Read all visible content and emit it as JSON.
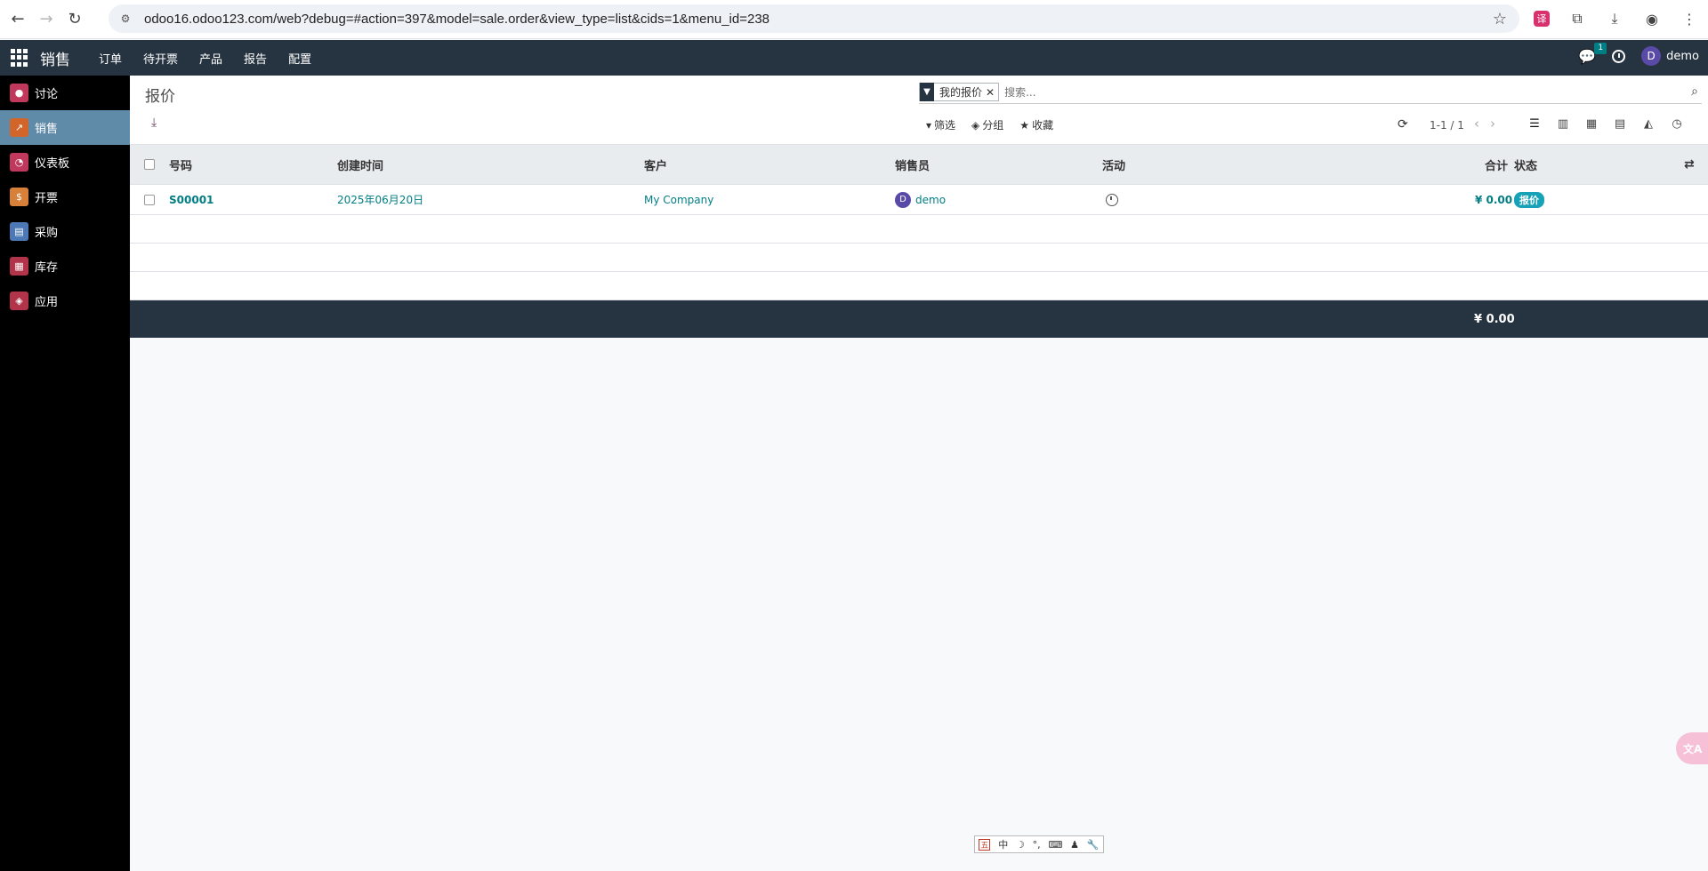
{
  "browser": {
    "url": "odoo16.odoo123.com/web?debug=#action=397&model=sale.order&view_type=list&cids=1&menu_id=238"
  },
  "navbar": {
    "brand": "销售",
    "menu": [
      "订单",
      "待开票",
      "产品",
      "报告",
      "配置"
    ],
    "chat_count": "1",
    "user_initial": "D",
    "user_name": "demo"
  },
  "sidebar": {
    "items": [
      {
        "label": "讨论",
        "icon": "discuss-icon",
        "color": "#c0395d"
      },
      {
        "label": "销售",
        "icon": "sales-icon",
        "color": "#d2652a",
        "active": true
      },
      {
        "label": "仪表板",
        "icon": "dashboard-icon",
        "color": "#c0395d"
      },
      {
        "label": "开票",
        "icon": "invoicing-icon",
        "color": "#d6803a"
      },
      {
        "label": "采购",
        "icon": "purchase-icon",
        "color": "#4c79b5"
      },
      {
        "label": "库存",
        "icon": "inventory-icon",
        "color": "#b2344a"
      },
      {
        "label": "应用",
        "icon": "apps-icon",
        "color": "#b2344a"
      }
    ]
  },
  "control_panel": {
    "title": "报价",
    "facet_label": "我的报价",
    "search_placeholder": "搜索...",
    "filter_label": "筛选",
    "group_label": "分组",
    "favorite_label": "收藏",
    "pager": "1-1 / 1"
  },
  "list": {
    "columns": {
      "number": "号码",
      "created": "创建时间",
      "customer": "客户",
      "salesperson": "销售员",
      "activity": "活动",
      "total": "合计",
      "status": "状态"
    },
    "rows": [
      {
        "number": "S00001",
        "created": "2025年06月20日",
        "customer": "My Company",
        "salesperson_initial": "D",
        "salesperson": "demo",
        "total": "¥ 0.00",
        "status": "报价"
      }
    ],
    "footer_total": "¥ 0.00"
  },
  "ime": {
    "items": [
      "五",
      "中",
      "☽",
      "°,",
      "⌨",
      "♟",
      "🔧"
    ]
  },
  "colors": {
    "navbar": "#263442",
    "accent": "#017e84",
    "sidebar_active": "#5f8aa8",
    "status_badge": "#17a2b8"
  }
}
